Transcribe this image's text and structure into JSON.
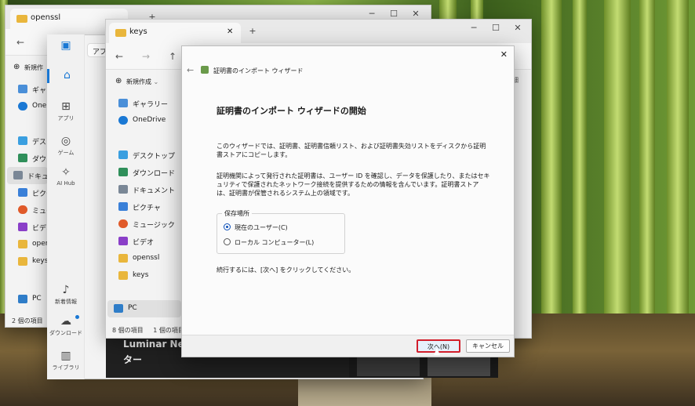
{
  "background": {
    "colors": {
      "bamboo": "#8db64a",
      "ground": "#5a4a2a"
    }
  },
  "window_openssl": {
    "tab_title": "openssl",
    "new_label": "新規作",
    "sidebar": [
      {
        "label": "ギャラ"
      },
      {
        "label": "One"
      },
      {
        "label": "デスク"
      },
      {
        "label": "ダウン"
      },
      {
        "label": "ドキュ"
      },
      {
        "label": "ピクチ"
      },
      {
        "label": "ミュー"
      },
      {
        "label": "ビデオ"
      },
      {
        "label": "oper"
      },
      {
        "label": "keys"
      },
      {
        "label": "PC"
      }
    ],
    "status": "2 個の項目"
  },
  "window_app": {
    "address_partial": "アプ",
    "rail": [
      {
        "label": ""
      },
      {
        "label": "アプリ"
      },
      {
        "label": "ゲーム"
      },
      {
        "label": "AI Hub"
      },
      {
        "label": "新着情報"
      },
      {
        "label": "ダウンロード"
      },
      {
        "label": "ライブラリ"
      }
    ],
    "banner_title": "Luminar Ne",
    "banner_sub": "ター"
  },
  "window_keys": {
    "tab_title": "keys",
    "new_label": "新規作成",
    "sidebar": [
      {
        "label": "ギャラリー",
        "pinned": false
      },
      {
        "label": "OneDrive",
        "pinned": false
      },
      {
        "label": "デスクトップ",
        "pinned": true
      },
      {
        "label": "ダウンロード",
        "pinned": true
      },
      {
        "label": "ドキュメント",
        "pinned": true
      },
      {
        "label": "ピクチャ",
        "pinned": true
      },
      {
        "label": "ミュージック",
        "pinned": true
      },
      {
        "label": "ビデオ",
        "pinned": true
      },
      {
        "label": "openssl",
        "pinned": true
      },
      {
        "label": "keys",
        "pinned": false
      },
      {
        "label": "PC",
        "pinned": false
      }
    ],
    "status_count": "8 個の項目",
    "status_selected": "1 個の項目",
    "right_partial_1": "細",
    "right_partial_2": "サイ"
  },
  "wizard": {
    "header_title": "証明書のインポート ウィザード",
    "heading": "証明書のインポート ウィザードの開始",
    "para1": "このウィザードでは、証明書、証明書信頼リスト、および証明書失効リストをディスクから証明書ストアにコピーします。",
    "para2": "証明機関によって発行された証明書は、ユーザー ID を確認し、データを保護したり、またはセキュリティで保護されたネットワーク接続を提供するための情報を含んでいます。証明書ストアは、証明書が保管されるシステム上の領域です。",
    "store_group_title": "保存場所",
    "option_current_user": "現在のユーザー(C)",
    "option_local_machine": "ローカル コンピューター(L)",
    "selected_option": "current_user",
    "continue_text": "続行するには、[次へ] をクリックしてください。",
    "next_button": "次へ(N)",
    "cancel_button": "キャンセル",
    "colors": {
      "accent": "#0d4fb7",
      "highlight": "#d21e2b"
    }
  }
}
